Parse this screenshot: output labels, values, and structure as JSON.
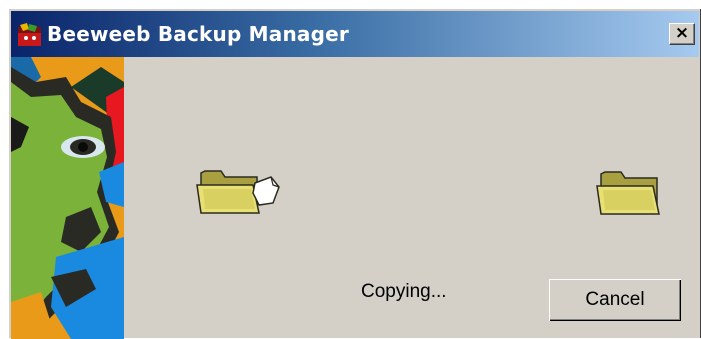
{
  "window": {
    "title": "Beeweeb Backup Manager",
    "close_label": "×",
    "icons": {
      "app": "app-icon",
      "close": "close-icon",
      "source_folder": "folder-open-file-icon",
      "destination_folder": "folder-icon",
      "side_image": "cartoon-face-banner"
    }
  },
  "progress": {
    "status": "Copying..."
  },
  "buttons": {
    "cancel_label": "Cancel"
  },
  "colors": {
    "title_gradient_start": "#0a246a",
    "title_gradient_end": "#a6caf0",
    "dialog_background": "#d4d0c8",
    "folder_yellow": "#e8e074"
  }
}
